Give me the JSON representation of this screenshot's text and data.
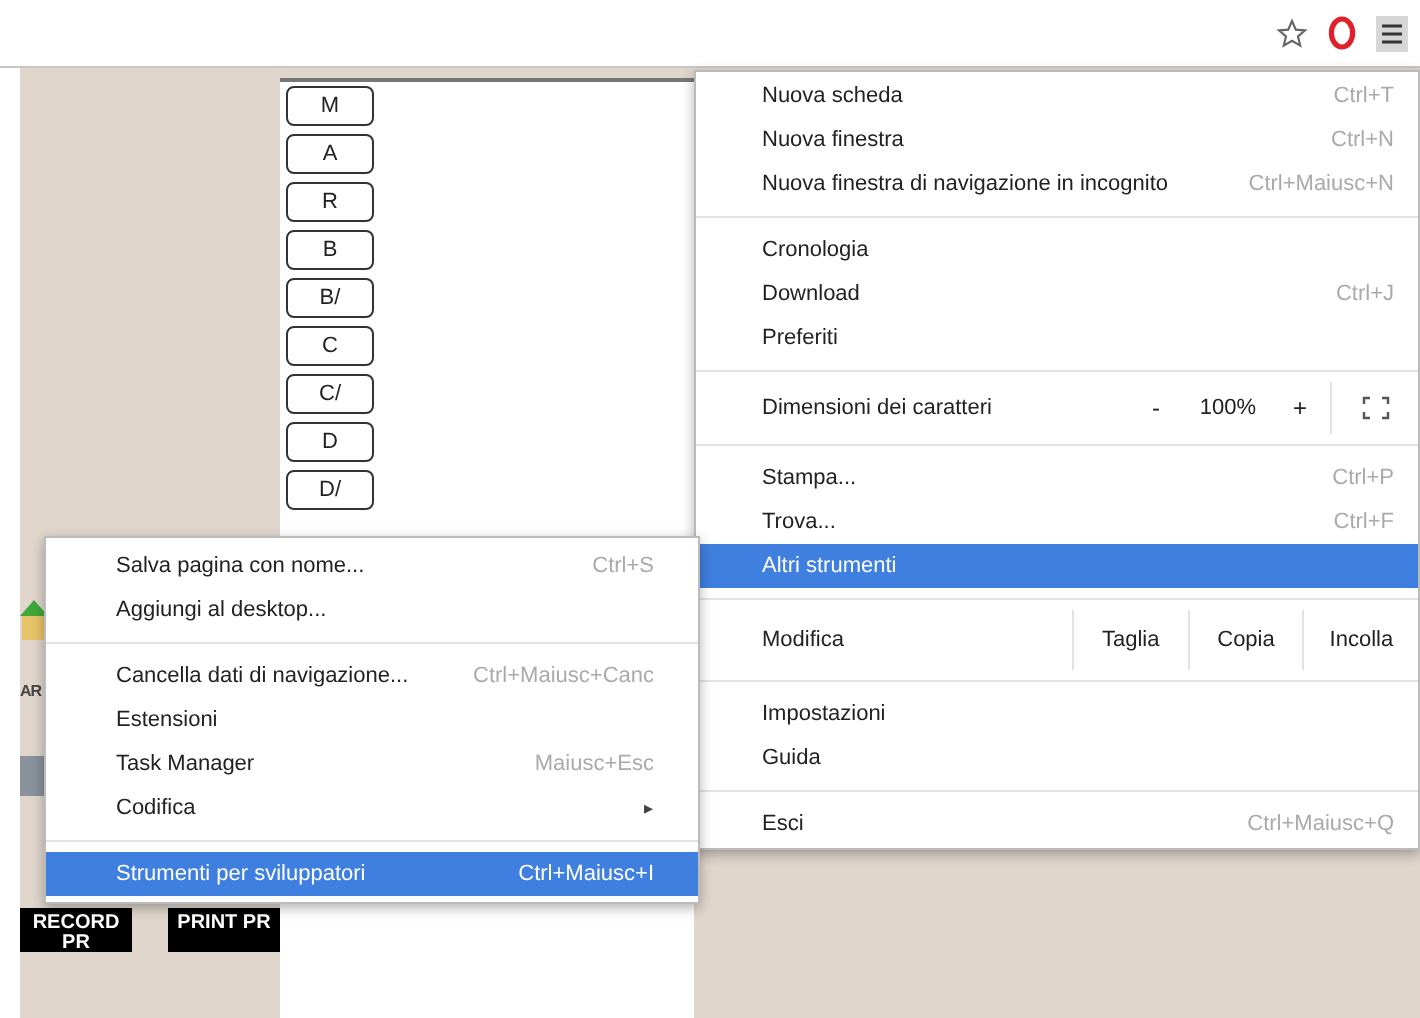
{
  "page": {
    "letter_buttons": [
      "M",
      "A",
      "R",
      "B",
      "B/",
      "C",
      "C/",
      "D",
      "D/"
    ],
    "side_label": "AR",
    "action_buttons": [
      "RECORD PR",
      "PRINT PR"
    ]
  },
  "main_menu": {
    "items": [
      {
        "kind": "item",
        "label": "Nuova scheda",
        "shortcut": "Ctrl+T",
        "selected": false
      },
      {
        "kind": "item",
        "label": "Nuova finestra",
        "shortcut": "Ctrl+N",
        "selected": false
      },
      {
        "kind": "item",
        "label": "Nuova finestra di navigazione in incognito",
        "shortcut": "Ctrl+Maiusc+N",
        "selected": false
      },
      {
        "kind": "separator"
      },
      {
        "kind": "item",
        "label": "Cronologia",
        "selected": false
      },
      {
        "kind": "item",
        "label": "Download",
        "shortcut": "Ctrl+J",
        "selected": false
      },
      {
        "kind": "item",
        "label": "Preferiti",
        "selected": false
      },
      {
        "kind": "separator"
      },
      {
        "kind": "zoom",
        "label": "Dimensioni dei caratteri",
        "minus": "-",
        "value": "100%",
        "plus": "+"
      },
      {
        "kind": "separator"
      },
      {
        "kind": "item",
        "label": "Stampa...",
        "shortcut": "Ctrl+P",
        "selected": false
      },
      {
        "kind": "item",
        "label": "Trova...",
        "shortcut": "Ctrl+F",
        "selected": false
      },
      {
        "kind": "item",
        "label": "Altri strumenti",
        "selected": true
      },
      {
        "kind": "separator"
      },
      {
        "kind": "edit",
        "label": "Modifica",
        "actions": [
          "Taglia",
          "Copia",
          "Incolla"
        ]
      },
      {
        "kind": "separator"
      },
      {
        "kind": "item",
        "label": "Impostazioni",
        "selected": false
      },
      {
        "kind": "item",
        "label": "Guida",
        "selected": false
      },
      {
        "kind": "separator"
      },
      {
        "kind": "item",
        "label": "Esci",
        "shortcut": "Ctrl+Maiusc+Q",
        "selected": false
      }
    ]
  },
  "submenu": {
    "items": [
      {
        "kind": "item",
        "label": "Salva pagina con nome...",
        "shortcut": "Ctrl+S",
        "selected": false
      },
      {
        "kind": "item",
        "label": "Aggiungi al desktop...",
        "selected": false
      },
      {
        "kind": "separator"
      },
      {
        "kind": "item",
        "label": "Cancella dati di navigazione...",
        "shortcut": "Ctrl+Maiusc+Canc",
        "selected": false
      },
      {
        "kind": "item",
        "label": "Estensioni",
        "selected": false
      },
      {
        "kind": "item",
        "label": "Task Manager",
        "shortcut": "Maiusc+Esc",
        "selected": false
      },
      {
        "kind": "item",
        "label": "Codifica",
        "arrow": "▸",
        "selected": false
      },
      {
        "kind": "separator"
      },
      {
        "kind": "item",
        "label": "Strumenti per sviluppatori",
        "shortcut": "Ctrl+Maiusc+I",
        "selected": true
      }
    ]
  }
}
